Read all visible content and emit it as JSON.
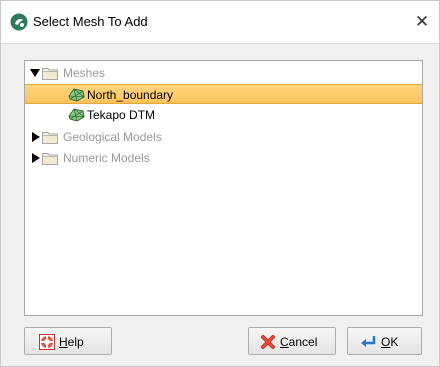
{
  "window": {
    "title": "Select Mesh To Add",
    "close_symbol": "✕"
  },
  "tree": {
    "items": [
      {
        "label": "Meshes",
        "expanded": true,
        "type": "folder",
        "enabled": false
      },
      {
        "label": "North_boundary",
        "type": "mesh",
        "selected": true
      },
      {
        "label": "Tekapo DTM",
        "type": "mesh",
        "selected": false
      },
      {
        "label": "Geological Models",
        "expanded": false,
        "type": "folder",
        "enabled": false
      },
      {
        "label": "Numeric Models",
        "expanded": false,
        "type": "folder",
        "enabled": false
      }
    ]
  },
  "buttons": {
    "help": {
      "mnemonic": "H",
      "rest": "elp"
    },
    "cancel": {
      "mnemonic": "C",
      "rest": "ancel"
    },
    "ok": {
      "mnemonic": "O",
      "rest": "K"
    }
  },
  "colors": {
    "selection": "#fbc35a",
    "mesh_icon": "#5aa35a",
    "folder_icon": "#e8d7a3"
  }
}
